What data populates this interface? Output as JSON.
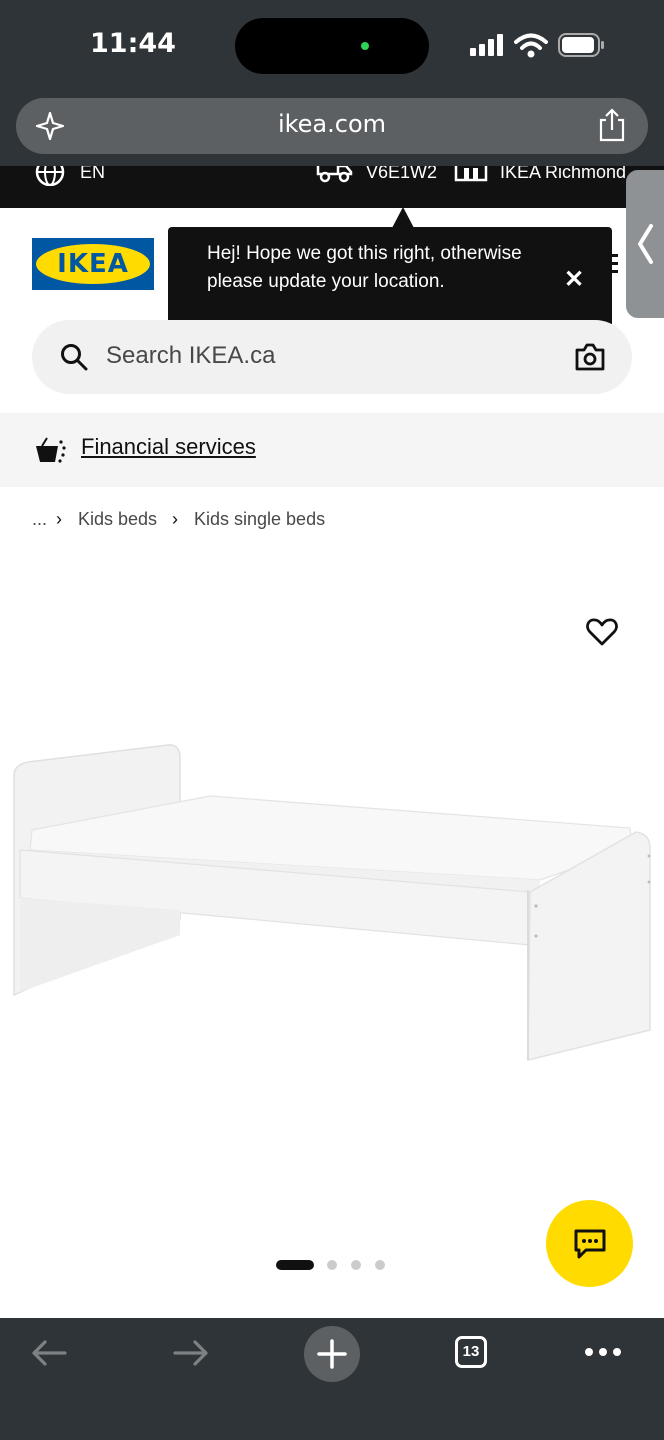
{
  "status_bar": {
    "time": "11:44"
  },
  "browser": {
    "url": "ikea.com",
    "tab_count": "13"
  },
  "utility_strip": {
    "language": "EN",
    "postal_code": "V6E1W2",
    "store": "IKEA Richmond"
  },
  "header": {
    "logo_text": "IKEA",
    "location_tooltip": "Hej! Hope we got this right, otherwise please update your location."
  },
  "search": {
    "placeholder": "Search IKEA.ca"
  },
  "promo": {
    "financial_services": "Financial services"
  },
  "breadcrumb": {
    "ellipsis": "...",
    "items": [
      "Kids beds",
      "Kids single beds"
    ]
  },
  "carousel": {
    "image_count": 4,
    "active_index": 0
  },
  "colors": {
    "ikea_blue": "#0058a3",
    "ikea_yellow": "#ffdb00",
    "browser_chrome": "#2f3438"
  }
}
